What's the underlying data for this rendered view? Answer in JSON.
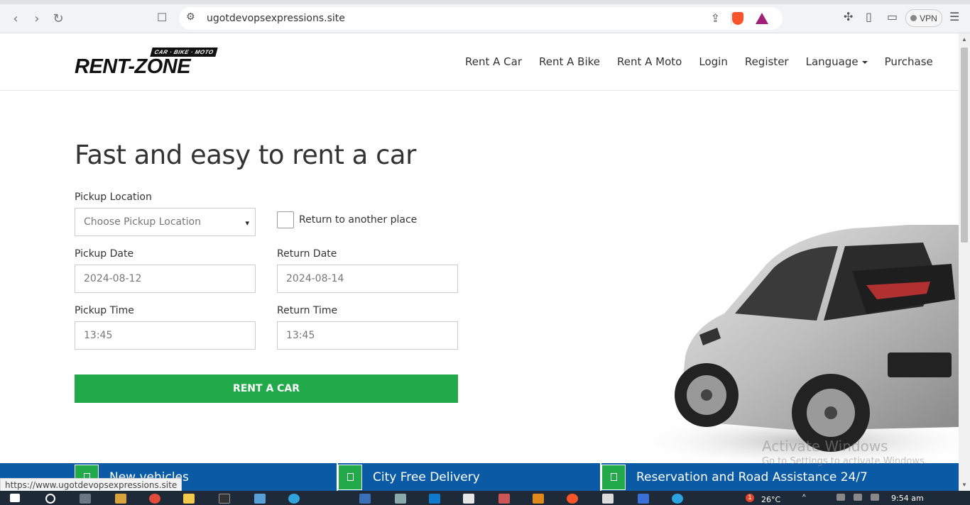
{
  "browser": {
    "url": "ugotdevopsexpressions.site",
    "vpn_label": "VPN",
    "status_url": "https://www.ugotdevopsexpressions.site"
  },
  "site": {
    "logo": {
      "word": "RENT-ZONE",
      "tag": "CAR · BIKE · MOTO"
    },
    "nav": [
      {
        "label": "Rent A Car"
      },
      {
        "label": "Rent A Bike"
      },
      {
        "label": "Rent A Moto"
      },
      {
        "label": "Login"
      },
      {
        "label": "Register"
      },
      {
        "label": "Language"
      },
      {
        "label": "Purchase"
      }
    ]
  },
  "hero": {
    "title": "Fast and easy to rent a car"
  },
  "form": {
    "pickup_location_label": "Pickup Location",
    "pickup_location_value": "Choose Pickup Location",
    "return_other_label": "Return to another place",
    "return_other_checked": false,
    "pickup_date_label": "Pickup Date",
    "pickup_date_value": "2024-08-12",
    "return_date_label": "Return Date",
    "return_date_value": "2024-08-14",
    "pickup_time_label": "Pickup Time",
    "pickup_time_value": "13:45",
    "return_time_label": "Return Time",
    "return_time_value": "13:45",
    "submit_label": "RENT A CAR"
  },
  "features": [
    {
      "label": "New vehicles"
    },
    {
      "label": "City Free Delivery"
    },
    {
      "label": "Reservation and Road Assistance 24/7"
    }
  ],
  "watermark": {
    "line1": "Activate Windows",
    "line2": "Go to Settings to activate Windows."
  },
  "taskbar": {
    "time": "9:54 am",
    "temp": "26°C",
    "notification_count": "1"
  },
  "colors": {
    "accent_green": "#22aa4a",
    "feature_blue": "#0b5aa6"
  }
}
